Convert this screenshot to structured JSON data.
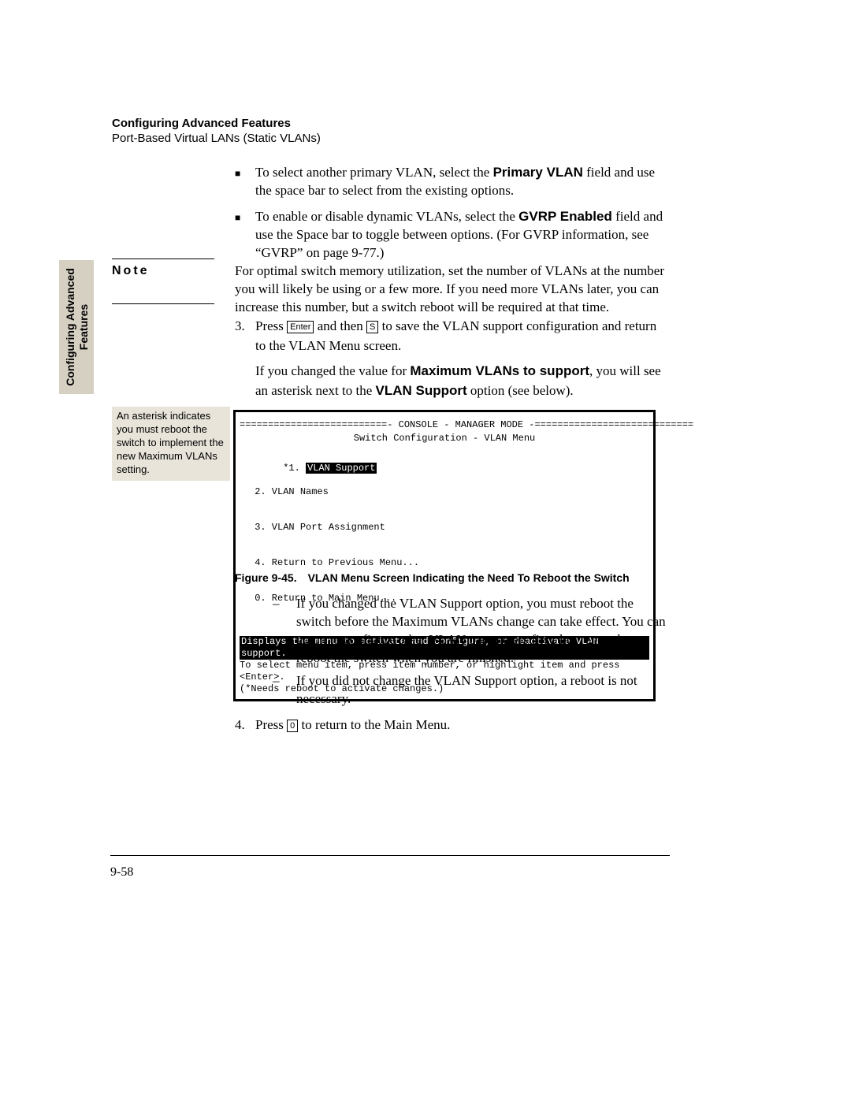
{
  "sideTab": {
    "line1": "Configuring Advanced",
    "line2": "Features"
  },
  "header": {
    "title": "Configuring Advanced Features",
    "sub": "Port-Based Virtual LANs (Static VLANs)"
  },
  "bullets": [
    {
      "pre": "To select another primary VLAN, select the ",
      "bold": "Primary VLAN",
      "post": " field and use the space bar to select from the existing options."
    },
    {
      "pre": "To enable or disable dynamic VLANs, select the ",
      "bold": "GVRP Enabled",
      "post": " field and use the Space bar to toggle between options. (For GVRP information, see “GVRP” on page 9-77.)"
    }
  ],
  "note": {
    "label": "Note",
    "text": "For optimal switch memory utilization, set the number of VLANs at the number you will likely be using or a few more. If you need more VLANs later, you can increase this number, but a switch reboot will be required at that time."
  },
  "step3": {
    "num": "3.",
    "line1_a": "Press ",
    "kbd1": "Enter",
    "line1_b": " and then ",
    "kbd2": "S",
    "line1_c": " to save the VLAN support configuration and return to the VLAN Menu screen.",
    "line2_a": "If you changed the value for ",
    "bold1": "Maximum VLANs to support",
    "line2_b": ", you will see an asterisk next to the ",
    "bold2": "VLAN Support",
    "line2_c": " option (see below)."
  },
  "callout": "An asterisk indicates you must reboot the switch to implement the new Maximum VLANs setting.",
  "console": {
    "bar": "==========================- CONSOLE - MANAGER MODE -============================",
    "title": "Switch Configuration - VLAN Menu",
    "star": "*",
    "item1_num": "1.",
    "item1": "VLAN Support",
    "item2": "2. VLAN Names",
    "item3": "3. VLAN Port Assignment",
    "item4": "4. Return to Previous Menu...",
    "item0": "0. Return to Main Menu...",
    "help_inv": "Displays the menu to activate and configure, or deactivate VLAN support.",
    "help2": "To select menu item, press item number, or highlight item and press <Enter>.",
    "help3": "(*Needs reboot to activate changes.)"
  },
  "figCaption": "Figure 9-45. VLAN Menu Screen Indicating the Need To Reboot the Switch",
  "sub": [
    "If you changed the VLAN Support option, you must reboot the switch before the Maximum VLANs change can take effect. You can go on to configure other VLAN parameters first, but remember to reboot the switch when you are finished.",
    "If you did not change the VLAN Support option, a reboot is not necessary."
  ],
  "step4": {
    "num": "4.",
    "a": "Press ",
    "kbd": "0",
    "b": " to return to the Main Menu."
  },
  "pageNum": "9-58"
}
